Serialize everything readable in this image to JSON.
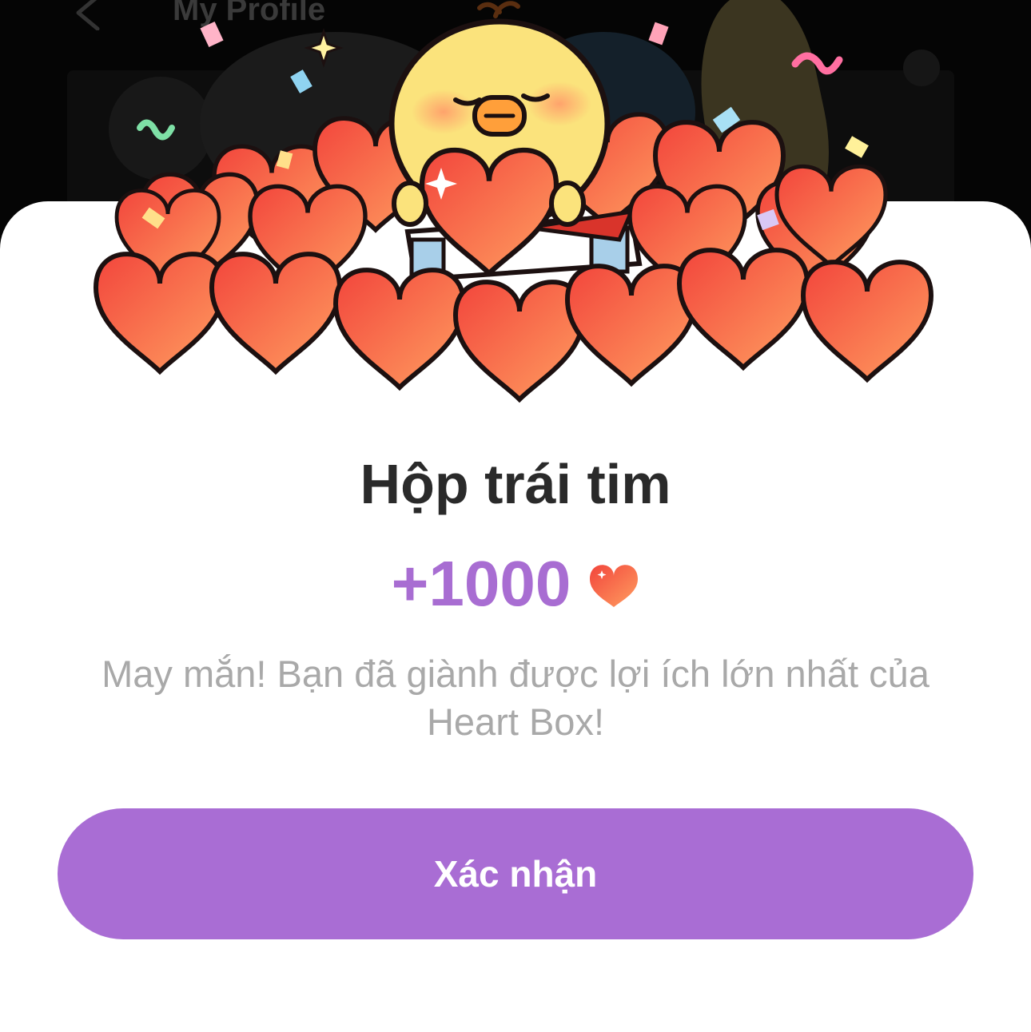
{
  "background_app": {
    "title": "My Profile"
  },
  "modal": {
    "title": "Hộp trái tim",
    "reward_amount": "+1000",
    "reward_icon": "heart-icon",
    "description": "May mắn! Bạn đã giành được lợi ích lớn nhất của Heart Box!",
    "confirm_label": "Xác nhận"
  },
  "colors": {
    "accent_purple": "#a96dd4",
    "reward_text": "#a86dd2",
    "heart_red": "#f24a3c",
    "heart_orange": "#ff9a5c",
    "title_text": "#2a2a2a",
    "description_text": "#a9a9a9"
  }
}
